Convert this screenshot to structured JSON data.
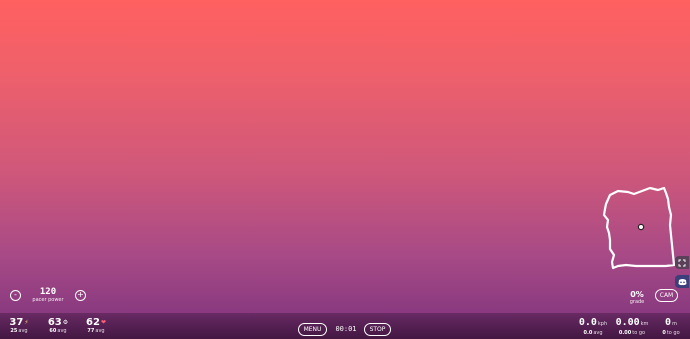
{
  "pacer": {
    "minus_label": "-",
    "plus_label": "+",
    "value": "120",
    "label": "pacer power"
  },
  "grade": {
    "value": "0%",
    "label": "grade"
  },
  "cam": {
    "label": "CAM"
  },
  "controls": {
    "menu_label": "MENU",
    "timer": "00:01",
    "stop_label": "STOP"
  },
  "metrics": {
    "power": {
      "value": "37",
      "icon": "lightning-icon",
      "avg_value": "25",
      "avg_label": "avg"
    },
    "cadence": {
      "value": "63",
      "icon": "gear-icon",
      "avg_value": "60",
      "avg_label": "avg"
    },
    "heart_rate": {
      "value": "62",
      "icon": "heart-icon",
      "avg_value": "77",
      "avg_label": "avg"
    },
    "speed": {
      "value": "0.0",
      "unit": "kph",
      "avg_value": "0.0",
      "avg_label": "avg"
    },
    "distance": {
      "value": "0.00",
      "unit": "km",
      "togo_value": "0.00",
      "togo_label": "to go"
    },
    "elevation": {
      "value": "0",
      "unit": "m",
      "togo_value": "0",
      "togo_label": "to go"
    }
  },
  "icons": [
    "lightning-icon",
    "gear-icon",
    "heart-icon",
    "fullscreen-icon",
    "discord-icon",
    "map-position-icon"
  ],
  "colors": {
    "bg_top": "#ff6060",
    "bg_bottom": "#6e2e6a",
    "accent": "#ffffff"
  }
}
